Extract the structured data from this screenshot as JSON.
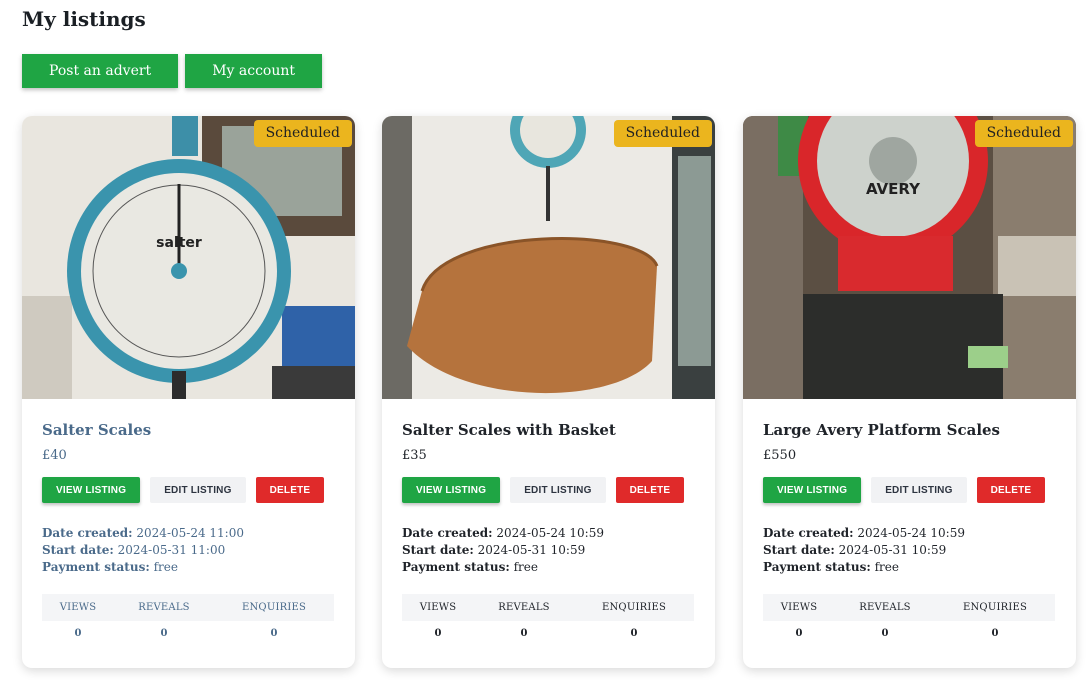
{
  "page": {
    "title": "My listings"
  },
  "top_actions": {
    "post_label": "Post an advert",
    "account_label": "My account"
  },
  "listings": [
    {
      "title": "Salter Scales",
      "price": "£40",
      "badge": "Scheduled",
      "view_label": "VIEW LISTING",
      "edit_label": "EDIT LISTING",
      "delete_label": "DELETE",
      "date_created_label": "Date created:",
      "date_created": "2024-05-24 11:00",
      "start_date_label": "Start date:",
      "start_date": "2024-05-31 11:00",
      "payment_label": "Payment status:",
      "payment": "free",
      "stats": {
        "views_label": "VIEWS",
        "reveals_label": "REVEALS",
        "enquiries_label": "ENQUIRIES",
        "views": "0",
        "reveals": "0",
        "enquiries": "0"
      }
    },
    {
      "title": "Salter Scales with Basket",
      "price": "£35",
      "badge": "Scheduled",
      "view_label": "VIEW LISTING",
      "edit_label": "EDIT LISTING",
      "delete_label": "DELETE",
      "date_created_label": "Date created:",
      "date_created": "2024-05-24 10:59",
      "start_date_label": "Start date:",
      "start_date": "2024-05-31 10:59",
      "payment_label": "Payment status:",
      "payment": "free",
      "stats": {
        "views_label": "VIEWS",
        "reveals_label": "REVEALS",
        "enquiries_label": "ENQUIRIES",
        "views": "0",
        "reveals": "0",
        "enquiries": "0"
      }
    },
    {
      "title": "Large Avery Platform Scales",
      "price": "£550",
      "badge": "Scheduled",
      "view_label": "VIEW LISTING",
      "edit_label": "EDIT LISTING",
      "delete_label": "DELETE",
      "date_created_label": "Date created:",
      "date_created": "2024-05-24 10:59",
      "start_date_label": "Start date:",
      "start_date": "2024-05-31 10:59",
      "payment_label": "Payment status:",
      "payment": "free",
      "stats": {
        "views_label": "VIEWS",
        "reveals_label": "REVEALS",
        "enquiries_label": "ENQUIRIES",
        "views": "0",
        "reveals": "0",
        "enquiries": "0"
      }
    }
  ],
  "photo_text": {
    "salter_brand": "salter",
    "avery_brand": "AVERY"
  },
  "colors": {
    "green": "#1fa544",
    "red": "#e02a2a",
    "badge": "#ebb51e",
    "link_blue": "#4a6a8a"
  }
}
